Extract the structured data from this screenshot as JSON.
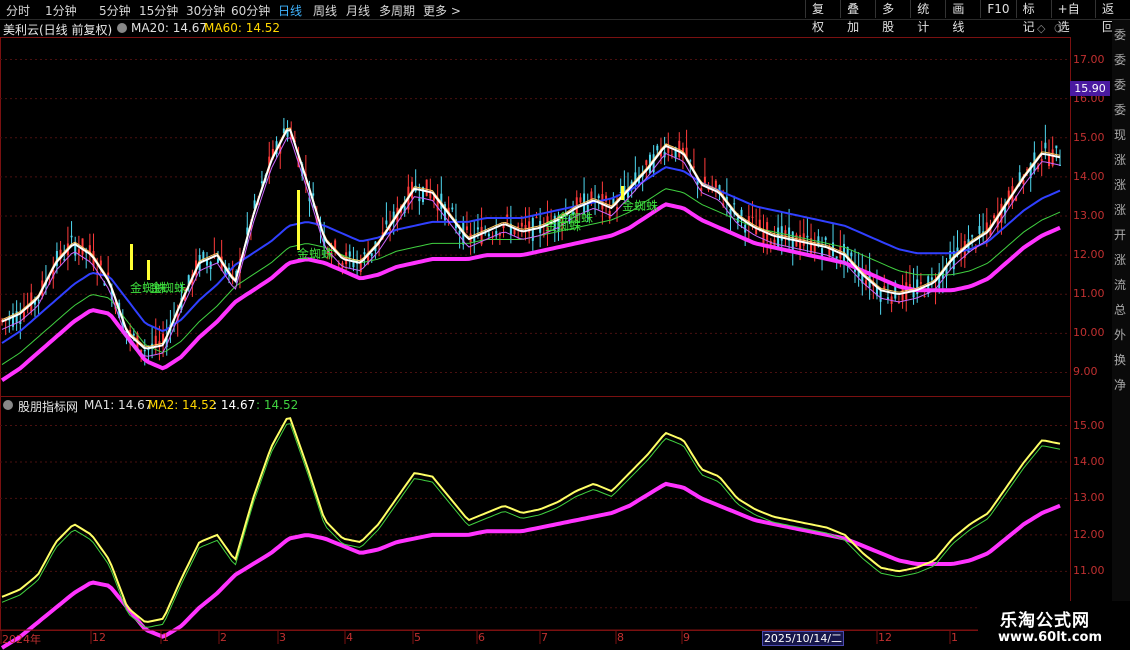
{
  "toolbar": {
    "periods": [
      "分时",
      "1分钟",
      "5分钟",
      "15分钟",
      "30分钟",
      "60分钟",
      "日线",
      "周线",
      "月线",
      "多周期",
      "更多"
    ],
    "active_period": "日线",
    "right_buttons": [
      "复权",
      "叠加",
      "多股",
      "统计",
      "画线",
      "F10",
      "标记",
      "+自选",
      "返回"
    ]
  },
  "main_panel": {
    "stock_name": "美利云(日线 前复权)",
    "ma20_label": "MA20: 14.67",
    "ma60_label": "MA60: 14.52",
    "price_axis": [
      "17.00",
      "16.00",
      "15.00",
      "14.00",
      "13.00",
      "12.00",
      "11.00",
      "10.00",
      "9.00"
    ],
    "current_price_tag": "15.90",
    "annotation_text": "金蜘蛛"
  },
  "sub_panel": {
    "indicator_name": "股朋指标网",
    "ma1_label": "MA1: 14.67",
    "ma2_label": "MA2: 14.52",
    "extra1": ": 14.67",
    "extra2": ": 14.52",
    "axis": [
      "15.00",
      "14.00",
      "13.00",
      "12.00",
      "11.00",
      "10.00"
    ]
  },
  "time_axis": {
    "labels": [
      "2024年",
      "12",
      "1",
      "2",
      "3",
      "4",
      "5",
      "6",
      "7",
      "8",
      "9",
      "12",
      "1"
    ],
    "cursor_date": "2025/10/14/二"
  },
  "watermark": {
    "title": "乐淘公式网",
    "url": "www.60lt.com"
  },
  "sidebar_chars": [
    "委",
    "委",
    "委",
    "委",
    "现",
    "涨",
    "涨",
    "涨",
    "开",
    "涨",
    "流",
    "总",
    "外",
    "换",
    "净"
  ],
  "colors": {
    "background": "#000000",
    "up_candle": "#ff3b3b",
    "down_candle": "#4fd8f0",
    "white_line": "#ffffff",
    "magenta_line": "#ff33ff",
    "yellow_line": "#ffff66",
    "green_line": "#40d040",
    "blue_line": "#3040ff",
    "active_tab": "#3fb4ff"
  },
  "chart_data": {
    "type": "line",
    "title": "美利云(日线 前复权)",
    "price_ylim": [
      8.5,
      17.5
    ],
    "indicator_ylim": [
      9.5,
      15.7
    ],
    "x_periods": [
      "2024年",
      "12",
      "1",
      "2",
      "3",
      "4",
      "5",
      "6",
      "7",
      "8",
      "9",
      "12",
      "1"
    ],
    "series": [
      {
        "name": "MA20",
        "values": [
          10.3,
          10.5,
          10.9,
          11.8,
          12.3,
          12.0,
          11.3,
          10.0,
          9.6,
          9.7,
          10.8,
          11.8,
          12.0,
          11.3,
          13.0,
          14.4,
          15.3,
          13.9,
          12.4,
          11.9,
          11.8,
          12.3,
          13.0,
          13.7,
          13.6,
          13.0,
          12.4,
          12.6,
          12.8,
          12.6,
          12.7,
          12.9,
          13.2,
          13.4,
          13.2,
          13.7,
          14.2,
          14.8,
          14.6,
          13.8,
          13.6,
          13.0,
          12.7,
          12.5,
          12.4,
          12.3,
          12.2,
          12.0,
          11.5,
          11.1,
          11.0,
          11.1,
          11.3,
          11.9,
          12.3,
          12.6,
          13.3,
          14.0,
          14.6,
          14.5
        ]
      },
      {
        "name": "MA60",
        "values": [
          9.5,
          9.8,
          10.2,
          10.6,
          11.0,
          11.3,
          11.2,
          10.6,
          10.0,
          9.8,
          10.1,
          10.6,
          11.0,
          11.5,
          11.8,
          12.1,
          12.5,
          12.6,
          12.5,
          12.3,
          12.1,
          12.2,
          12.4,
          12.5,
          12.6,
          12.6,
          12.6,
          12.7,
          12.7,
          12.7,
          12.8,
          12.9,
          13.0,
          13.1,
          13.2,
          13.4,
          13.7,
          14.0,
          13.9,
          13.6,
          13.4,
          13.2,
          13.0,
          12.9,
          12.8,
          12.7,
          12.6,
          12.5,
          12.3,
          12.1,
          11.9,
          11.8,
          11.8,
          11.8,
          11.9,
          12.1,
          12.5,
          12.9,
          13.2,
          13.4
        ]
      }
    ]
  }
}
